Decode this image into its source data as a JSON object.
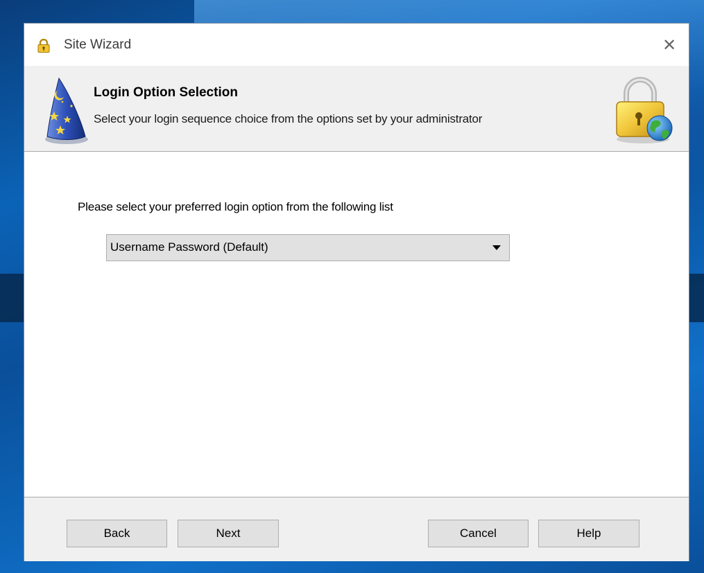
{
  "window": {
    "title": "Site Wizard",
    "close_glyph": "✕"
  },
  "header": {
    "title": "Login Option Selection",
    "subtitle": "Select your login sequence choice from the options set by your administrator",
    "left_icon": "wizard-hat-icon",
    "right_icon": "padlock-globe-icon"
  },
  "content": {
    "prompt": "Please select your preferred  login option from the following list",
    "login_option": {
      "selected": "Username Password  (Default)"
    }
  },
  "footer": {
    "back_label": "Back",
    "next_label": "Next",
    "cancel_label": "Cancel",
    "help_label": "Help"
  },
  "colors": {
    "dialog_chrome": "#f0f0f0",
    "button_face": "#e1e1e1",
    "button_border": "#adadad",
    "desktop_blue": "#0b63b7"
  }
}
